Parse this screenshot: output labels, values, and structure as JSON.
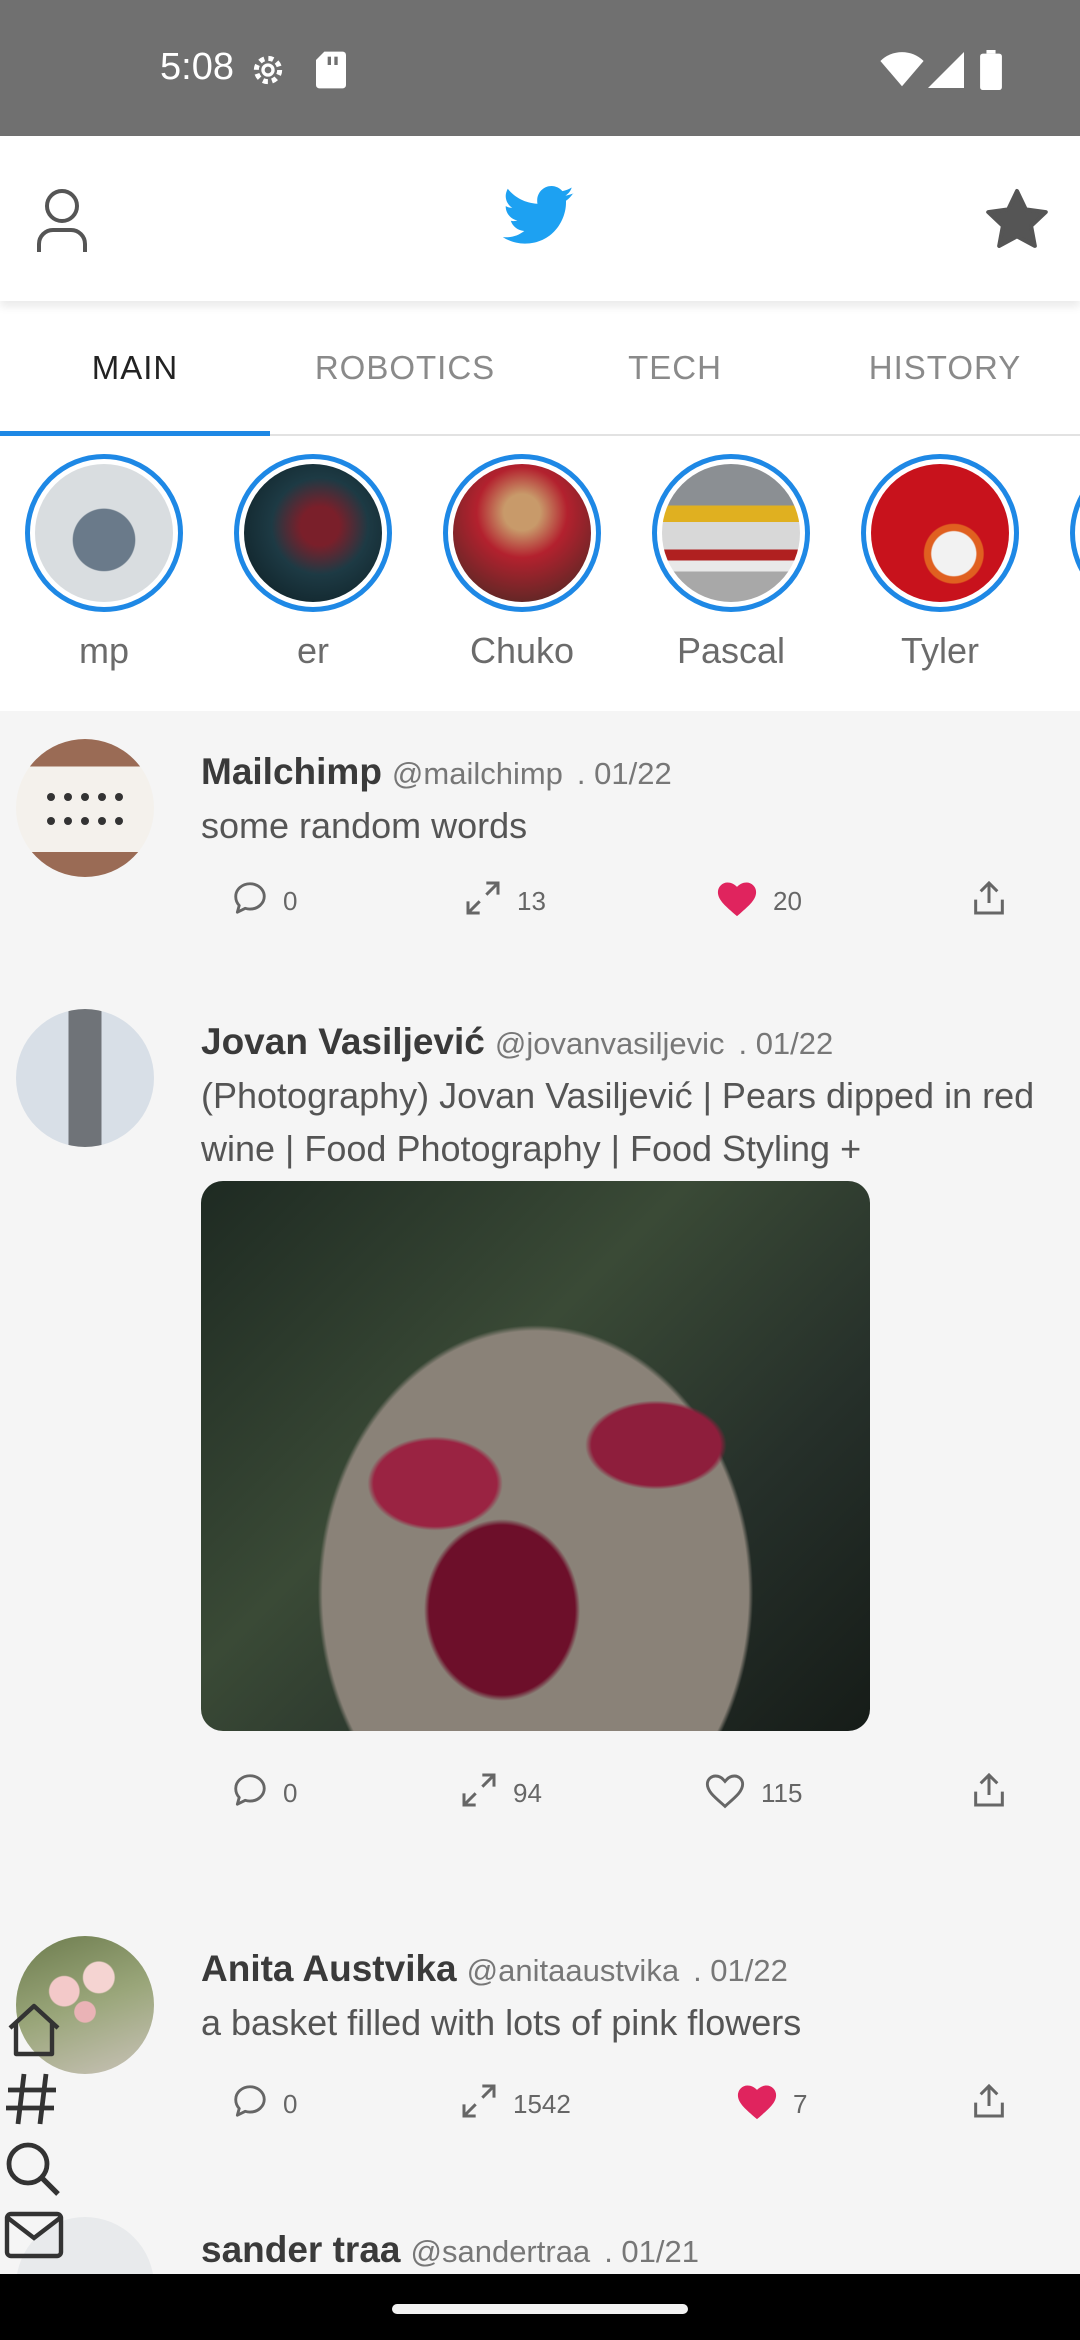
{
  "status_bar": {
    "time": "5:08",
    "icons": [
      "settings-gear-icon",
      "sd-card-icon",
      "wifi-icon",
      "cellular-signal-icon",
      "battery-icon"
    ]
  },
  "app_bar": {
    "left_icon": "profile-icon",
    "center_icon": "twitter-bird-icon",
    "right_icon": "star-icon",
    "brand_color": "#1da1f2"
  },
  "tabs": [
    {
      "label": "MAIN",
      "active": true
    },
    {
      "label": "ROBOTICS",
      "active": false
    },
    {
      "label": "TECH",
      "active": false
    },
    {
      "label": "HISTORY",
      "active": false
    }
  ],
  "accent_color": "#1e88e5",
  "stories": [
    {
      "name": "mp"
    },
    {
      "name": "er"
    },
    {
      "name": "Chuko"
    },
    {
      "name": "Pascal"
    },
    {
      "name": "Tyler"
    }
  ],
  "posts": [
    {
      "author": "Mailchimp",
      "handle": "@mailchimp",
      "date": ". 01/22",
      "text": "some random words",
      "comments": "0",
      "retweets": "13",
      "likes": "20",
      "liked": true
    },
    {
      "author": "Jovan Vasiljević",
      "handle": "@jovanvasiljevic",
      "date": ". 01/22",
      "text": "(Photography) Jovan Vasiljević | Pears dipped in red wine | Food Photography | Food Styling +",
      "comments": "0",
      "retweets": "94",
      "likes": "115",
      "liked": false
    },
    {
      "author": "Anita Austvika",
      "handle": "@anitaaustvika",
      "date": ". 01/22",
      "text": "a basket filled with lots of pink flowers",
      "comments": "0",
      "retweets": "1542",
      "likes": "7",
      "liked": true
    },
    {
      "author": "sander traa",
      "handle": "@sandertraa",
      "date": ". 01/21",
      "text": ""
    }
  ],
  "like_color": "#e0245e",
  "bottom_nav_icons": [
    "home-icon",
    "hashtag-icon",
    "search-icon",
    "mail-icon"
  ]
}
